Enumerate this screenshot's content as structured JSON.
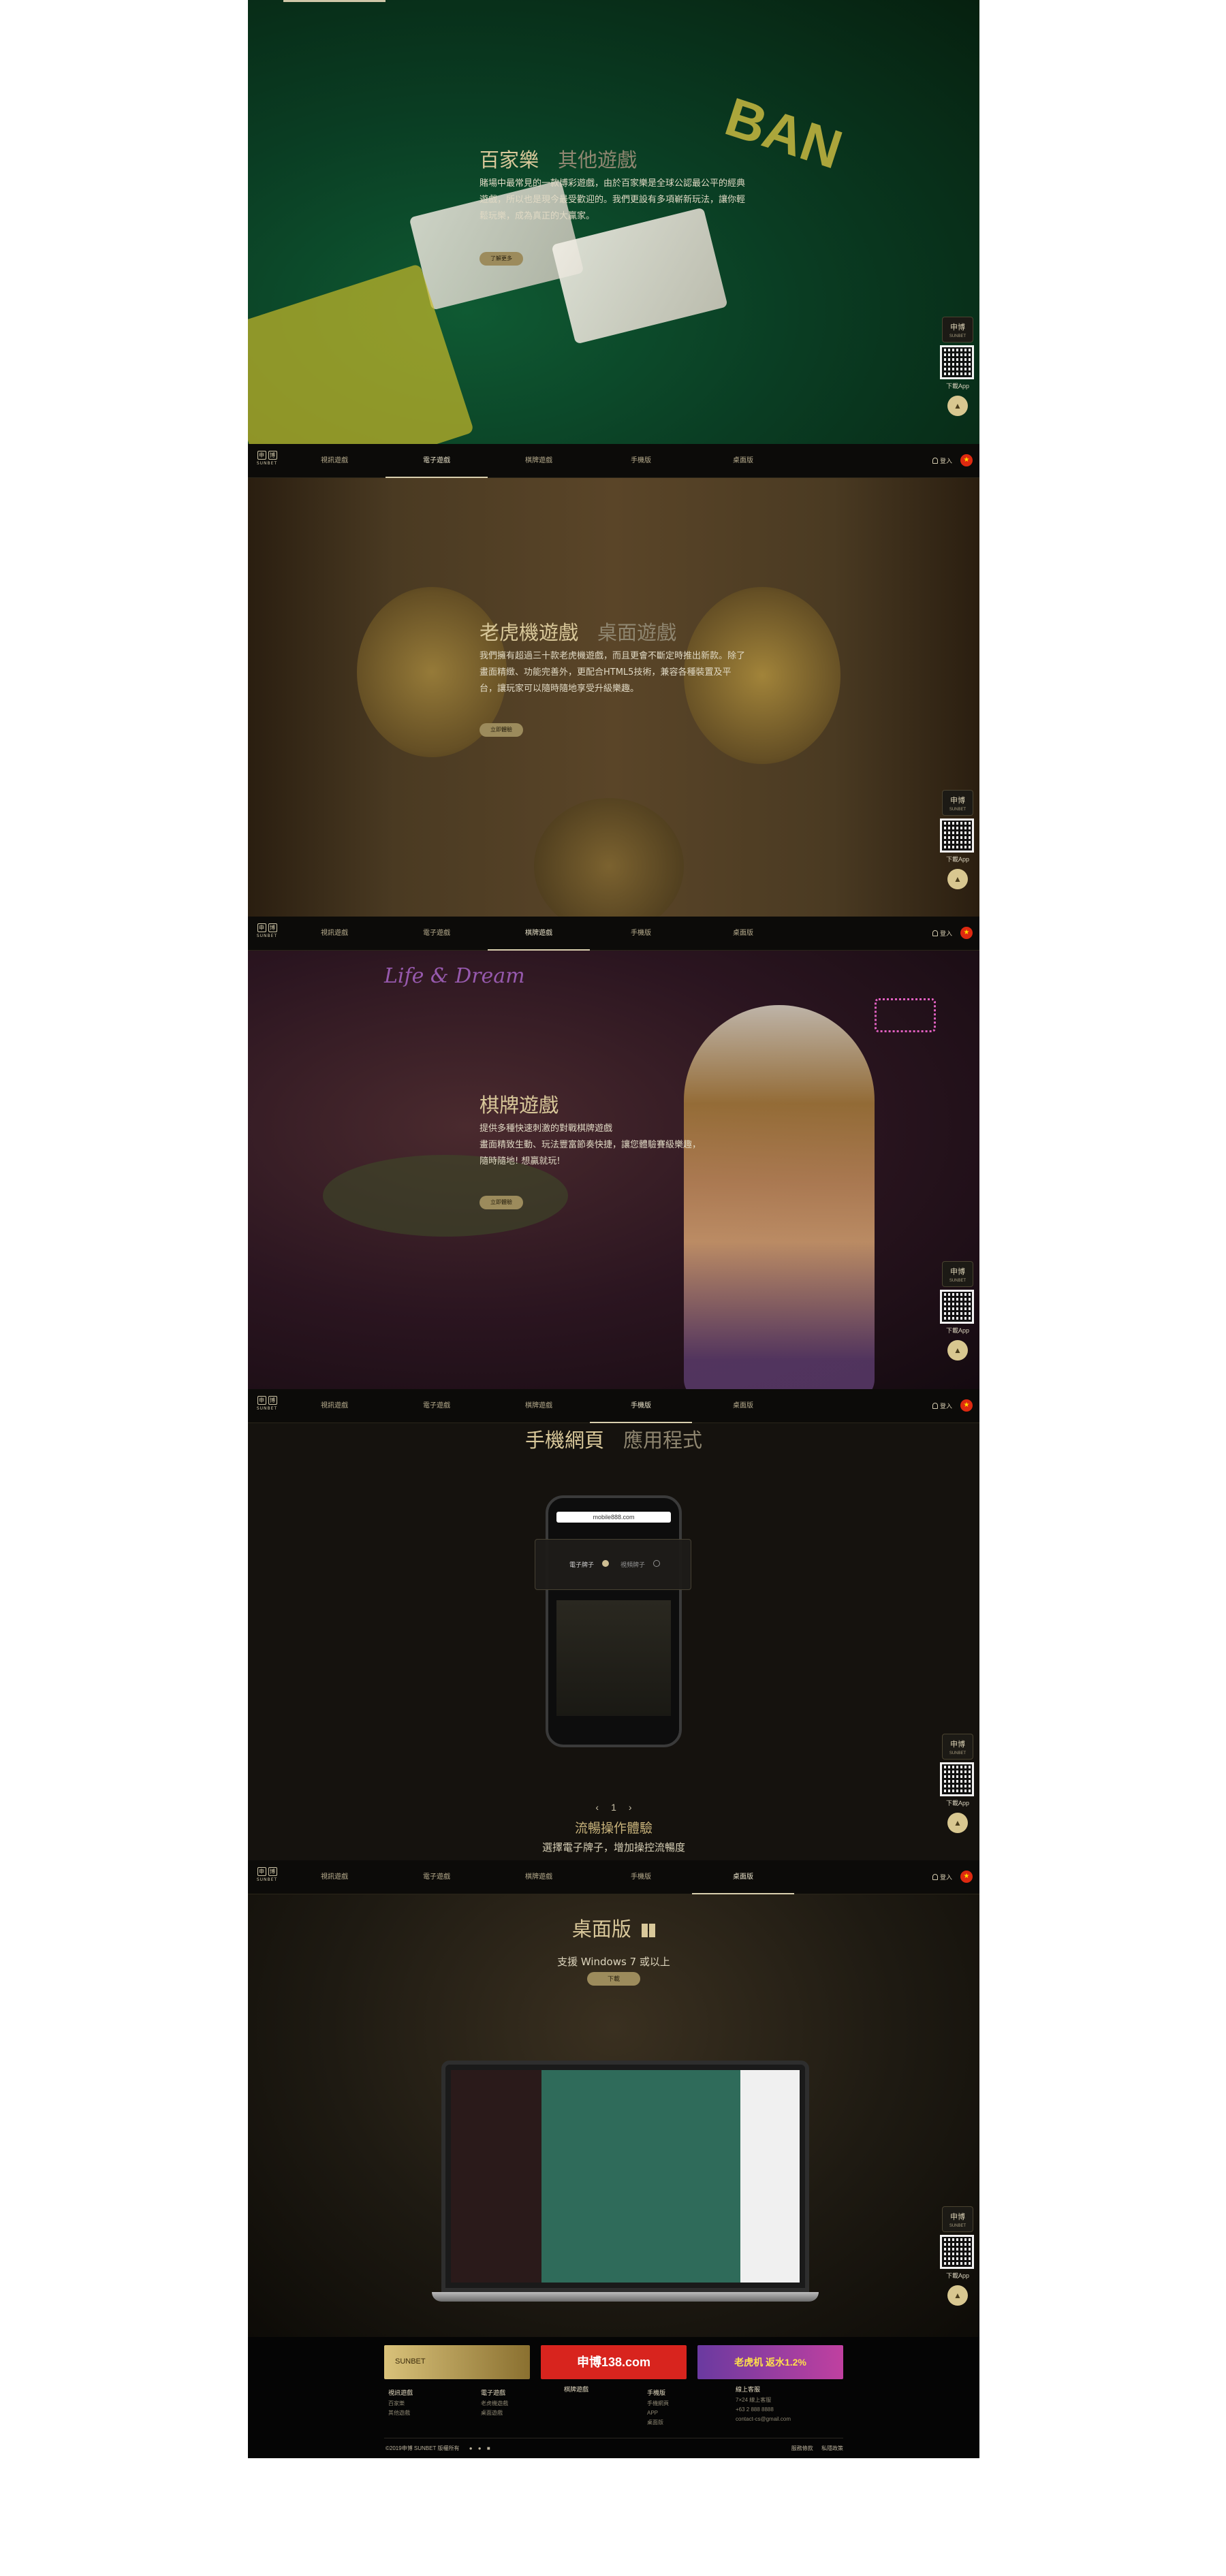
{
  "nav": {
    "items": [
      "視訊遊戲",
      "電子遊戲",
      "棋牌遊戲",
      "手機版",
      "桌面版"
    ],
    "login": "登入",
    "logo_text": "申博",
    "logo_sub": "SUNBET"
  },
  "sections": {
    "baccarat": {
      "title": "百家樂",
      "title_alt": "其他遊戲",
      "desc": "賭場中最常見的一款博彩遊戲，由於百家樂是全球公認最公平的經典遊戲，所以也是現今最受歡迎的。我們更設有多項嶄新玩法，讓你輕鬆玩樂，成為真正的大贏家。",
      "button": "了解更多"
    },
    "slots": {
      "title": "老虎機遊戲",
      "title_alt": "桌面遊戲",
      "desc": "我們擁有超過三十款老虎機遊戲，而且更會不斷定時推出新款。除了畫面精緻、功能完善外，更配合HTML5技術，兼容各種裝置及平台，讓玩家可以隨時隨地享受升級樂趣。",
      "button": "立即體驗"
    },
    "chess": {
      "title": "棋牌遊戲",
      "desc_lines": [
        "提供多種快速刺激的對戰棋牌遊戲",
        "畫面精致生動、玩法豐富節奏快捷，讓您體驗賽級樂趣，",
        "隨時隨地! 想贏就玩!"
      ],
      "button": "立即體驗"
    },
    "mobile": {
      "title": "手機網頁",
      "title_alt": "應用程式",
      "phone_url": "mobile888.com",
      "phone_opt1": "電子牌子",
      "phone_opt2": "視頻牌子",
      "pager": "1",
      "caption": "流暢操作體驗",
      "subcaption": "選擇電子牌子，增加操控流暢度"
    },
    "desktop": {
      "title": "桌面版",
      "subtitle": "支援 Windows 7 或以上",
      "button": "下載"
    }
  },
  "side_tool": {
    "logo": "申博",
    "logo_sub": "SUNBET",
    "qr_label": "下載App"
  },
  "footer": {
    "banners": [
      "SUNBET",
      "申博138.com",
      "老虎机 返水1.2%"
    ],
    "columns": [
      {
        "heading": "視訊遊戲",
        "items": [
          "百家樂",
          "其他遊戲"
        ]
      },
      {
        "heading": "電子遊戲",
        "items": [
          "老虎機遊戲",
          "桌面遊戲"
        ]
      },
      {
        "heading": "棋牌遊戲",
        "items": []
      },
      {
        "heading": "手機版",
        "items": [
          "手機網頁",
          "APP",
          "桌面版"
        ]
      },
      {
        "heading": "線上客服",
        "items": [
          "7×24 線上客服",
          "+63 2 888 8888",
          "contact-cs@gmail.com"
        ]
      }
    ],
    "copyright": "©2019申博 SUNBET 版權所有",
    "links": [
      "服務條款",
      "私隱政策"
    ]
  },
  "colors": {
    "gold": "#d9c89a",
    "button": "#9c8b5c",
    "nav_bg": "#0c0b09"
  }
}
